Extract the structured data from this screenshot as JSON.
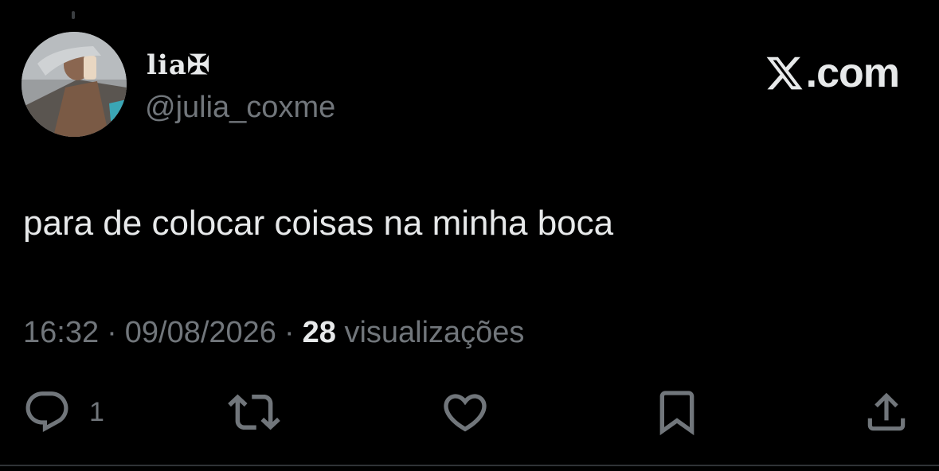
{
  "user": {
    "display_name": "lia✠",
    "handle": "@julia_coxme"
  },
  "brand": {
    "label": ".com",
    "icon": "x-logo-icon"
  },
  "tweet": {
    "text": "para de colocar coisas na minha boca"
  },
  "meta": {
    "time": "16:32",
    "separator": "·",
    "date": "09/08/2026",
    "views_count": "28",
    "views_label": "visualizações"
  },
  "actions": {
    "reply": {
      "icon": "reply-icon",
      "count": "1"
    },
    "retweet": {
      "icon": "retweet-icon"
    },
    "like": {
      "icon": "heart-icon"
    },
    "bookmark": {
      "icon": "bookmark-icon"
    },
    "share": {
      "icon": "share-icon"
    }
  },
  "colors": {
    "background": "#000000",
    "primary_text": "#e7e9ea",
    "secondary_text": "#71767b",
    "border": "#2f3336"
  }
}
